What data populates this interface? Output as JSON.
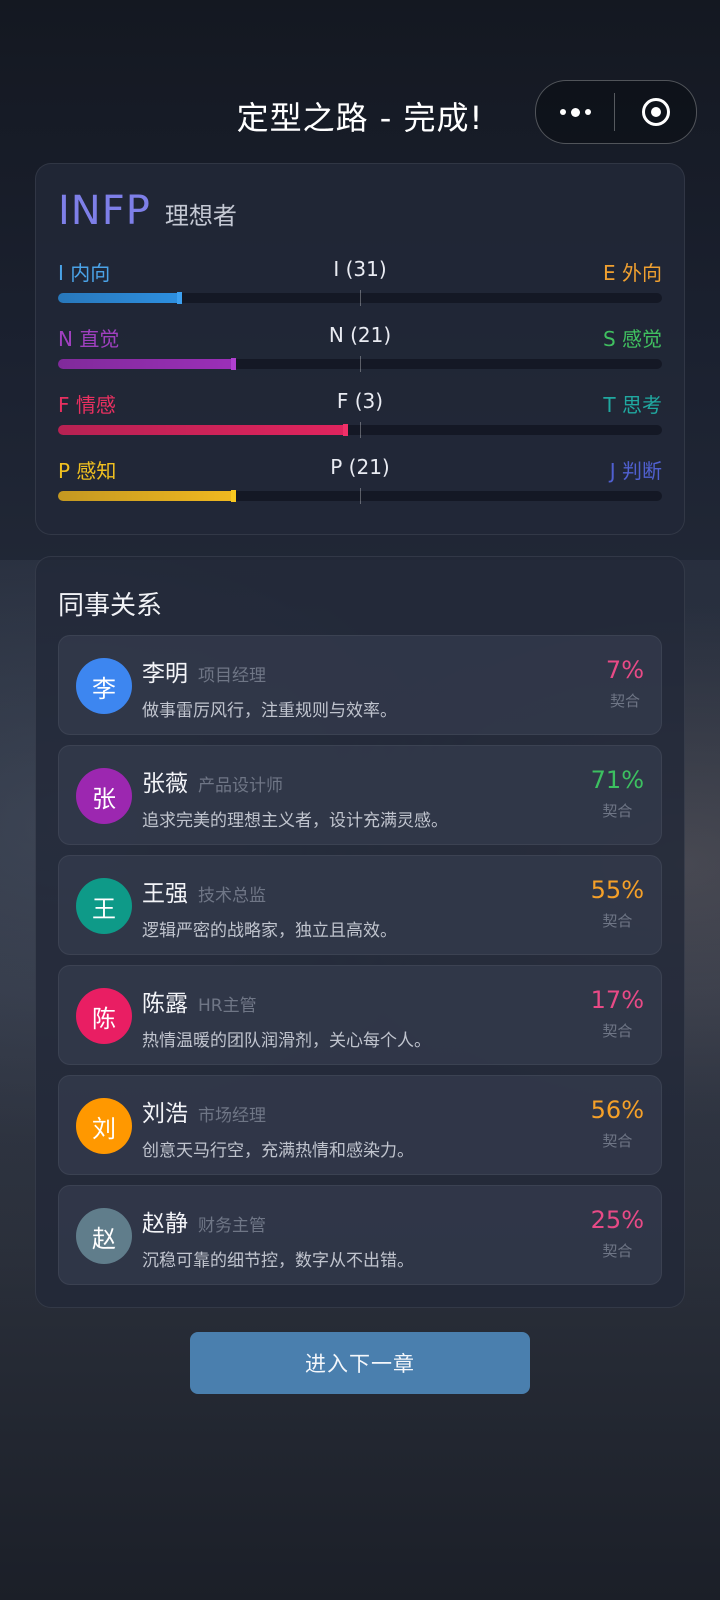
{
  "header": {
    "title": "定型之路 - 完成!"
  },
  "mbti": {
    "type": "INFP",
    "name": "理想者",
    "dimensions": [
      {
        "left": "I 内向",
        "mid": "I (31)",
        "right": "E 外向",
        "left_color": "#4aa3e8",
        "right_color": "#f0a030",
        "bar_color": "#2d8fe0",
        "fill_fraction": 0.2,
        "marker_color": "#3da0f0"
      },
      {
        "left": "N 直觉",
        "mid": "N (21)",
        "right": "S 感觉",
        "left_color": "#a040c0",
        "right_color": "#40c060",
        "bar_color": "#9b2fb8",
        "fill_fraction": 0.29,
        "marker_color": "#b040d0"
      },
      {
        "left": "F 情感",
        "mid": "F (3)",
        "right": "T 思考",
        "left_color": "#e83060",
        "right_color": "#20a8a0",
        "bar_color": "#e0245e",
        "fill_fraction": 0.475,
        "marker_color": "#f03068"
      },
      {
        "left": "P 感知",
        "mid": "P (21)",
        "right": "J 判断",
        "left_color": "#f0c020",
        "right_color": "#5060d0",
        "bar_color": "#f0b820",
        "fill_fraction": 0.29,
        "marker_color": "#f8c820"
      }
    ]
  },
  "colleagues": {
    "title": "同事关系",
    "items": [
      {
        "avatar": "李",
        "avatar_color": "#3d86f0",
        "name": "李明",
        "role": "项目经理",
        "desc": "做事雷厉风行，注重规则与效率。",
        "pct": "7%",
        "pct_color": "#e84a86",
        "pct_label": "契合"
      },
      {
        "avatar": "张",
        "avatar_color": "#9c27b0",
        "name": "张薇",
        "role": "产品设计师",
        "desc": "追求完美的理想主义者，设计充满灵感。",
        "pct": "71%",
        "pct_color": "#3cc060",
        "pct_label": "契合"
      },
      {
        "avatar": "王",
        "avatar_color": "#0e9a88",
        "name": "王强",
        "role": "技术总监",
        "desc": "逻辑严密的战略家，独立且高效。",
        "pct": "55%",
        "pct_color": "#f5a028",
        "pct_label": "契合"
      },
      {
        "avatar": "陈",
        "avatar_color": "#e91e63",
        "name": "陈露",
        "role": "HR主管",
        "desc": "热情温暖的团队润滑剂，关心每个人。",
        "pct": "17%",
        "pct_color": "#e84a86",
        "pct_label": "契合"
      },
      {
        "avatar": "刘",
        "avatar_color": "#ff9800",
        "name": "刘浩",
        "role": "市场经理",
        "desc": "创意天马行空，充满热情和感染力。",
        "pct": "56%",
        "pct_color": "#f5a028",
        "pct_label": "契合"
      },
      {
        "avatar": "赵",
        "avatar_color": "#607d8b",
        "name": "赵静",
        "role": "财务主管",
        "desc": "沉稳可靠的细节控，数字从不出错。",
        "pct": "25%",
        "pct_color": "#e84a86",
        "pct_label": "契合"
      }
    ]
  },
  "next_button": {
    "label": "进入下一章"
  }
}
